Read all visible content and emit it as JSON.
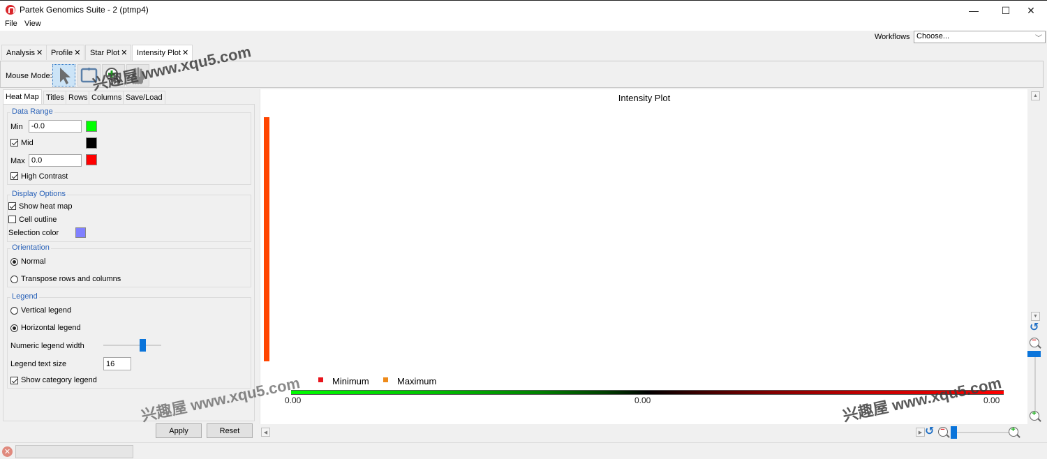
{
  "window": {
    "title": "Partek Genomics Suite - 2 (ptmp4)",
    "minimize": "—",
    "maximize": "☐",
    "close": "✕"
  },
  "menu": {
    "file": "File",
    "view": "View"
  },
  "workflows": {
    "label": "Workflows",
    "selected": "Choose..."
  },
  "doc_tabs": [
    {
      "label": "Analysis",
      "close": "✕",
      "active": false
    },
    {
      "label": "Profile",
      "close": "✕",
      "active": false
    },
    {
      "label": "Star Plot",
      "close": "✕",
      "active": false
    },
    {
      "label": "Intensity Plot",
      "close": "✕",
      "active": true
    }
  ],
  "toolbar": {
    "mouse_mode_label": "Mouse Mode:",
    "modes": [
      "select-pointer-icon",
      "lasso-select-icon",
      "zoom-in-icon",
      "pan-hand-icon"
    ],
    "active_mode": "select"
  },
  "panel_tabs": [
    {
      "label": "Heat Map",
      "active": true
    },
    {
      "label": "Titles",
      "active": false
    },
    {
      "label": "Rows",
      "active": false
    },
    {
      "label": "Columns",
      "active": false
    },
    {
      "label": "Save/Load",
      "active": false
    }
  ],
  "data_range": {
    "title": "Data Range",
    "min_label": "Min",
    "min_value": "-0.0",
    "min_color": "#00ff00",
    "mid_label": "Mid",
    "mid_checked": true,
    "mid_color": "#000000",
    "max_label": "Max",
    "max_value": "0.0",
    "max_color": "#ff0000",
    "high_contrast_label": "High Contrast",
    "high_contrast_checked": true
  },
  "display_options": {
    "title": "Display Options",
    "show_heat_map_label": "Show heat map",
    "show_heat_map_checked": true,
    "cell_outline_label": "Cell outline",
    "cell_outline_checked": false,
    "selection_color_label": "Selection color",
    "selection_color": "#8080ff"
  },
  "orientation": {
    "title": "Orientation",
    "normal_label": "Normal",
    "transpose_label": "Transpose rows and columns",
    "selected": "normal"
  },
  "legend": {
    "title": "Legend",
    "vertical_label": "Vertical legend",
    "horizontal_label": "Horizontal legend",
    "selected": "horizontal",
    "numeric_width_label": "Numeric legend width",
    "numeric_width_fraction": 0.68,
    "text_size_label": "Legend text size",
    "text_size_value": "16",
    "show_category_label": "Show category legend",
    "show_category_checked": true
  },
  "buttons": {
    "apply": "Apply",
    "reset": "Reset"
  },
  "plot": {
    "title": "Intensity Plot",
    "bar_color": "#ff4500",
    "category_legend": [
      {
        "label": "Minimum",
        "color": "#e8141c"
      },
      {
        "label": "Maximum",
        "color": "#ee8a1a"
      }
    ],
    "gradient_ticks": [
      "0.00",
      "0.00",
      "0.00"
    ],
    "zoom_slider_vertical_fraction": 0.0,
    "zoom_slider_horizontal_fraction": 0.0
  },
  "watermarks": [
    "兴趣屋 www.xqu5.com",
    "兴趣屋 www.xqu5.com",
    "兴趣屋 www.xqu5.com",
    "兴趣屋 www.xqu5.com"
  ]
}
